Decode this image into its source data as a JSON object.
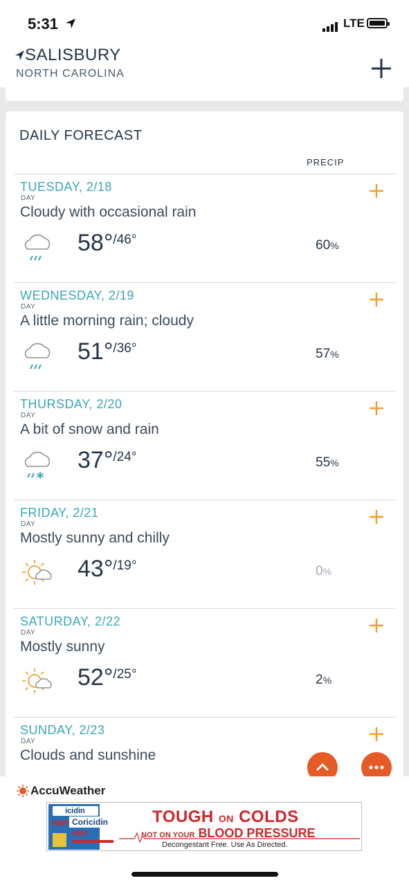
{
  "status_bar": {
    "time": "5:31",
    "network": "LTE"
  },
  "location": {
    "city": "SALISBURY",
    "state": "NORTH CAROLINA"
  },
  "forecast": {
    "title": "DAILY FORECAST",
    "precip_header": "PRECIP",
    "days": [
      {
        "date": "TUESDAY, 2/18",
        "period": "DAY",
        "desc": "Cloudy with occasional rain",
        "hi": "58°",
        "lo": "/46°",
        "precip": "60",
        "precip_unit": "%",
        "icon": "rain-cloud-icon"
      },
      {
        "date": "WEDNESDAY, 2/19",
        "period": "DAY",
        "desc": "A little morning rain; cloudy",
        "hi": "51°",
        "lo": "/36°",
        "precip": "57",
        "precip_unit": "%",
        "icon": "rain-cloud-icon"
      },
      {
        "date": "THURSDAY, 2/20",
        "period": "DAY",
        "desc": "A bit of snow and rain",
        "hi": "37°",
        "lo": "/24°",
        "precip": "55",
        "precip_unit": "%",
        "icon": "snow-rain-cloud-icon"
      },
      {
        "date": "FRIDAY, 2/21",
        "period": "DAY",
        "desc": "Mostly sunny and chilly",
        "hi": "43°",
        "lo": "/19°",
        "precip": "0",
        "precip_unit": "%",
        "icon": "mostly-sunny-icon"
      },
      {
        "date": "SATURDAY, 2/22",
        "period": "DAY",
        "desc": "Mostly sunny",
        "hi": "52°",
        "lo": "/25°",
        "precip": "2",
        "precip_unit": "%",
        "icon": "mostly-sunny-icon"
      },
      {
        "date": "SUNDAY, 2/23",
        "period": "DAY",
        "desc": "Clouds and sunshine",
        "hi": "",
        "lo": "",
        "precip": "",
        "precip_unit": "",
        "icon": "partly-sunny-icon"
      }
    ]
  },
  "footer": {
    "brand": "AccuWeather",
    "ad": {
      "product_top": "icidin",
      "product": "Coricidin",
      "hbp": "HBP",
      "headline_a": "TOUGH",
      "headline_on": "ON",
      "headline_b": "COLDS",
      "subheadline_a": "NOT ON YOUR",
      "subheadline_b": "BLOOD PRESSURE",
      "fineprint": "Decongestant Free. Use As Directed."
    }
  },
  "colors": {
    "accent_teal": "#3aa7b6",
    "plus_orange": "#f0a02a",
    "fab_orange": "#e55a25",
    "ad_red": "#d0252a"
  }
}
